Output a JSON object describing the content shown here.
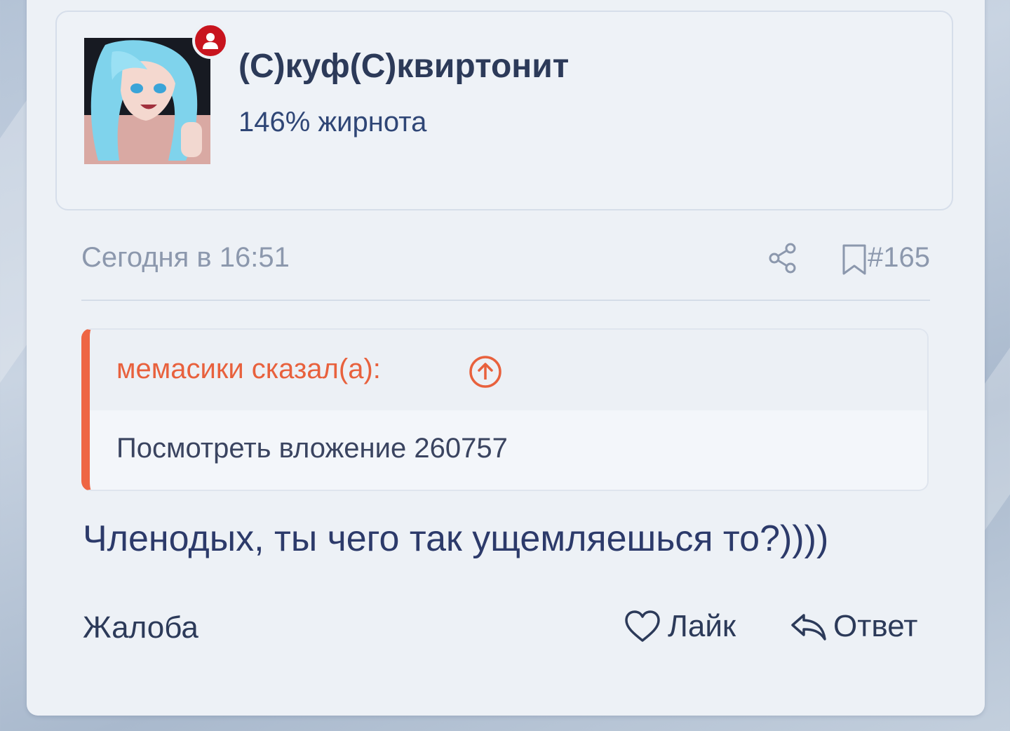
{
  "user": {
    "name": "(С)куф(С)квиртонит",
    "title": "146% жирнота"
  },
  "meta": {
    "timestamp": "Сегодня в 16:51",
    "post_number": "#165"
  },
  "quote": {
    "author": "мемасики сказал(а):",
    "body": "Посмотреть вложение 260757"
  },
  "message": "Членодых, ты чего так ущемляешься то?))))",
  "actions": {
    "report": "Жалоба",
    "like": "Лайк",
    "reply": "Ответ"
  },
  "icons": [
    "user-icon",
    "share-icon",
    "bookmark-icon",
    "arrow-up-circle-icon",
    "heart-icon",
    "reply-icon"
  ],
  "colors": {
    "accent": "#ee6644",
    "badge": "#c8141e",
    "text": "#2c3a59",
    "muted": "#8c98ad"
  }
}
